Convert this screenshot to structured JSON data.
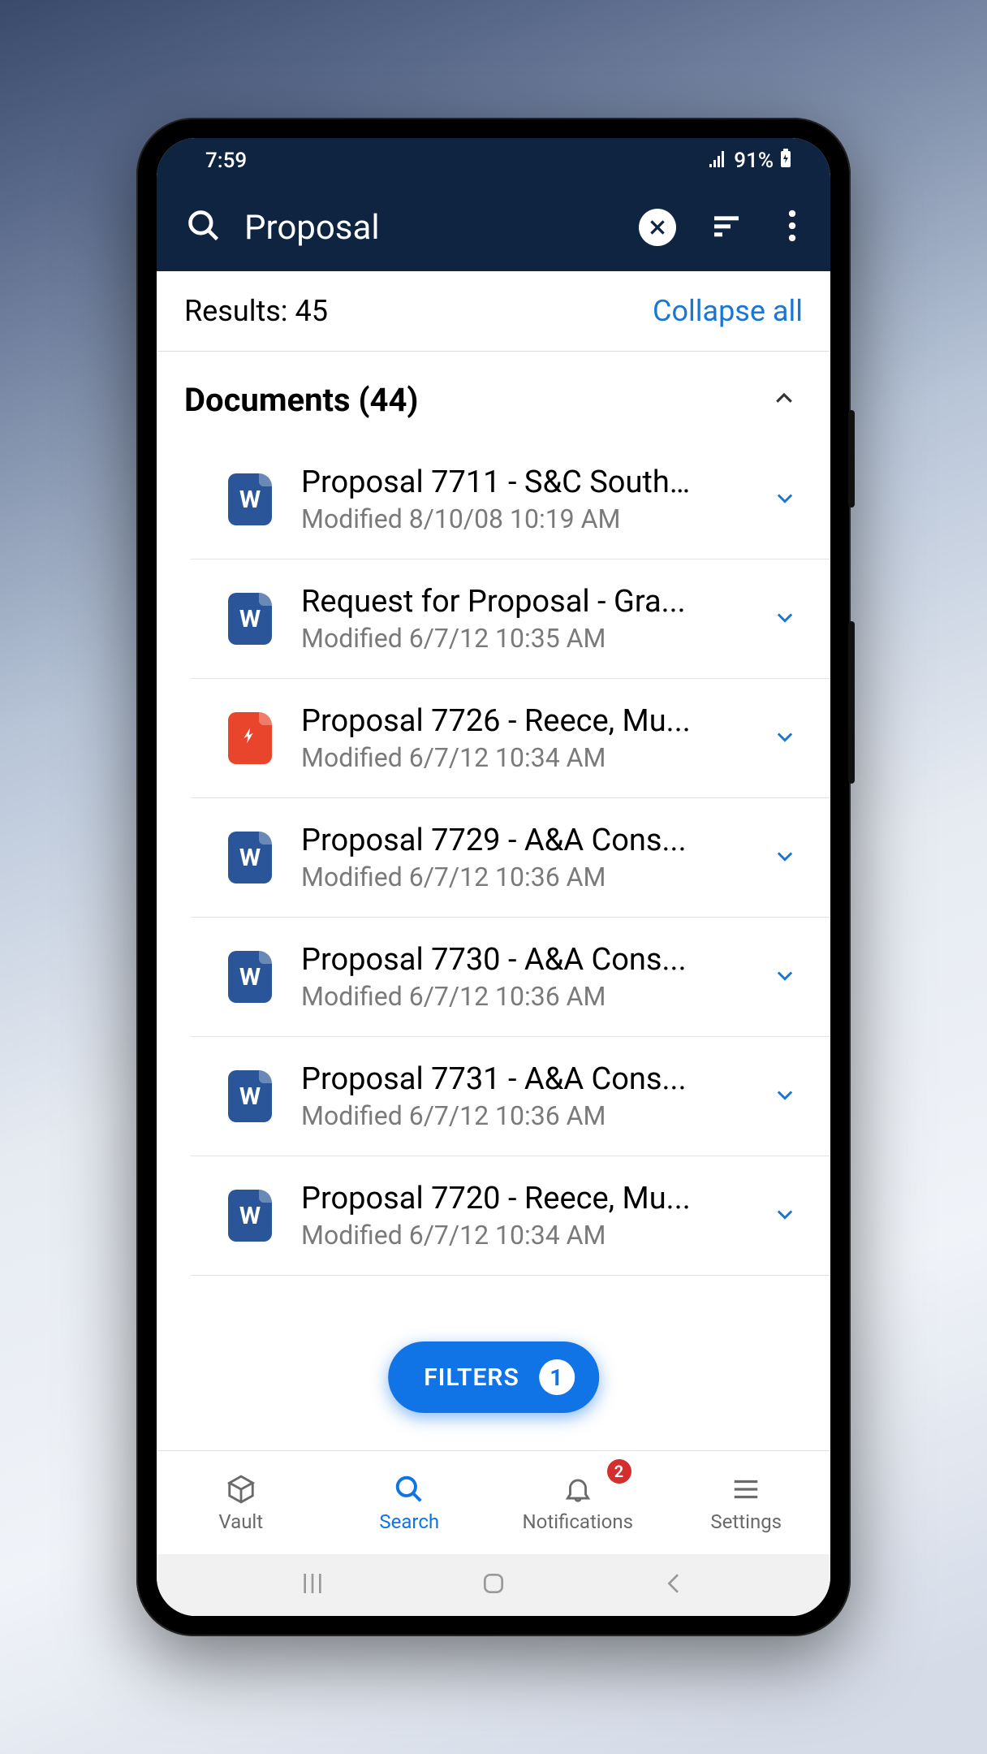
{
  "status": {
    "time": "7:59",
    "battery": "91%"
  },
  "header": {
    "search_value": "Proposal"
  },
  "results": {
    "label": "Results: 45",
    "collapse": "Collapse all"
  },
  "section": {
    "title": "Documents (44)"
  },
  "filters": {
    "label": "FILTERS",
    "count": "1"
  },
  "docs": [
    {
      "title": "Proposal 7711 - S&C South...",
      "meta": "Modified 8/10/08 10:19 AM",
      "type": "word"
    },
    {
      "title": "Request for Proposal - Gra...",
      "meta": "Modified 6/7/12 10:35 AM",
      "type": "word"
    },
    {
      "title": "Proposal 7726 - Reece, Mu...",
      "meta": "Modified 6/7/12 10:34 AM",
      "type": "pdf"
    },
    {
      "title": "Proposal 7729 - A&A Cons...",
      "meta": "Modified 6/7/12 10:36 AM",
      "type": "word"
    },
    {
      "title": "Proposal 7730 - A&A Cons...",
      "meta": "Modified 6/7/12 10:36 AM",
      "type": "word"
    },
    {
      "title": "Proposal 7731 - A&A Cons...",
      "meta": "Modified 6/7/12 10:36 AM",
      "type": "word"
    },
    {
      "title": "Proposal 7720 - Reece, Mu...",
      "meta": "Modified 6/7/12 10:34 AM",
      "type": "word"
    }
  ],
  "nav": {
    "vault": "Vault",
    "search": "Search",
    "notifications": "Notifications",
    "settings": "Settings",
    "badge": "2"
  }
}
